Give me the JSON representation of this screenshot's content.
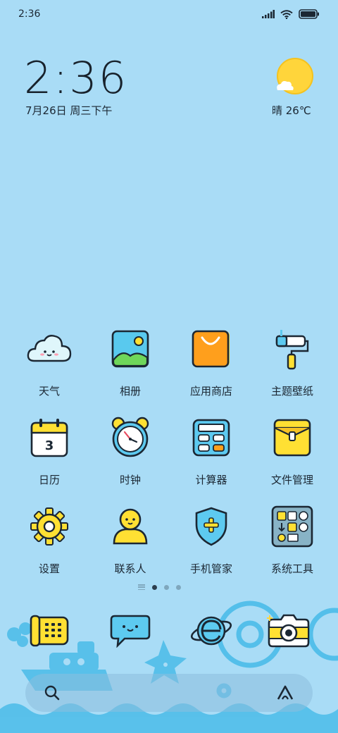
{
  "status_bar": {
    "time": "2:36"
  },
  "clock": {
    "time": "2:36",
    "date": "7月26日 周三下午"
  },
  "weather": {
    "condition_temp": "晴 26℃"
  },
  "apps": [
    {
      "label": "天气",
      "icon": "cloud-icon"
    },
    {
      "label": "相册",
      "icon": "gallery-icon"
    },
    {
      "label": "应用商店",
      "icon": "shopping-bag-icon"
    },
    {
      "label": "主题壁纸",
      "icon": "paint-roller-icon"
    },
    {
      "label": "日历",
      "icon": "calendar-icon"
    },
    {
      "label": "时钟",
      "icon": "alarm-clock-icon"
    },
    {
      "label": "计算器",
      "icon": "calculator-icon"
    },
    {
      "label": "文件管理",
      "icon": "folder-icon"
    },
    {
      "label": "设置",
      "icon": "gear-icon"
    },
    {
      "label": "联系人",
      "icon": "contact-icon"
    },
    {
      "label": "手机管家",
      "icon": "shield-icon"
    },
    {
      "label": "系统工具",
      "icon": "tools-icon"
    }
  ],
  "calendar_day": "3",
  "dock": [
    {
      "name": "phone",
      "icon": "phone-icon"
    },
    {
      "name": "messages",
      "icon": "chat-icon"
    },
    {
      "name": "browser",
      "icon": "browser-icon"
    },
    {
      "name": "camera",
      "icon": "camera-icon"
    }
  ],
  "pages": {
    "count": 3,
    "active": 1
  },
  "colors": {
    "background": "#a9dcf6",
    "accent_yellow": "#ffe033",
    "outline": "#1b2733"
  }
}
